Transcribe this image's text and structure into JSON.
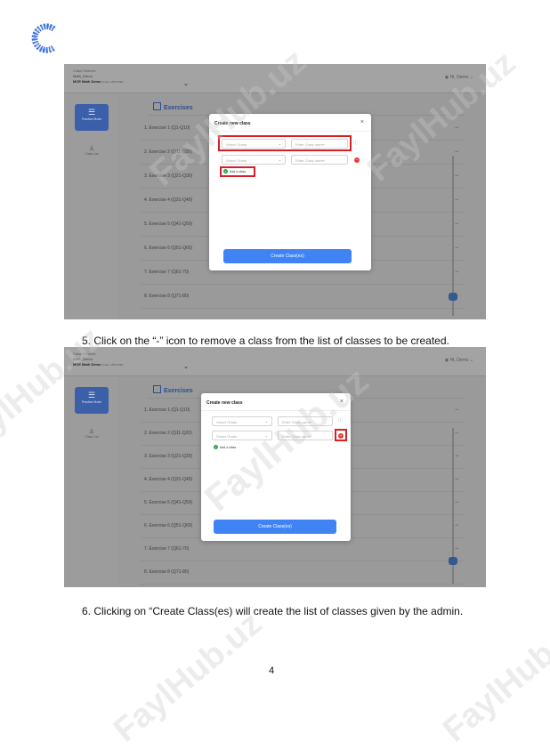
{
  "document": {
    "watermark": "FaylHub.uz",
    "page_number": "4",
    "step5": "5.   Click on the “-” icon to remove a class from the list of classes to be created.",
    "step6": "6.   Clicking on “Create Class(es) will create the list of classes given by the admin."
  },
  "colors": {
    "logo": "#3a6fd8",
    "highlight": "#d81f26",
    "primary": "#3f83f5"
  },
  "app": {
    "class_selector_label": "Class Selector",
    "user_name": "Math_Demo",
    "school_name": "MCE Math Demo",
    "school_code": "(Code: MPSYMB)",
    "greeting": "Hi, Demo",
    "sidebar_active": "Practice Mode",
    "sidebar_item": "Class List",
    "exercises_tab": "Exercises",
    "exercises": [
      "1. Exercise 1 (Q1-Q10)",
      "2. Exercise 2 (Q11-Q20)",
      "3. Exercise 3 (Q21-Q30)",
      "4. Exercise 4 (Q31-Q40)",
      "5. Exercise 5 (Q41-Q50)",
      "6. Exercise 6 (Q51-Q60)",
      "7. Exercise 7 (Q61-70)",
      "8. Exercise 8 (Q71-80)"
    ]
  },
  "modal": {
    "title": "Create new class",
    "select_grade_placeholder": "Select Grade",
    "class_name_placeholder": "Enter Class name*",
    "add_class_label": "Add a class",
    "create_button": "Create Class(es)"
  }
}
